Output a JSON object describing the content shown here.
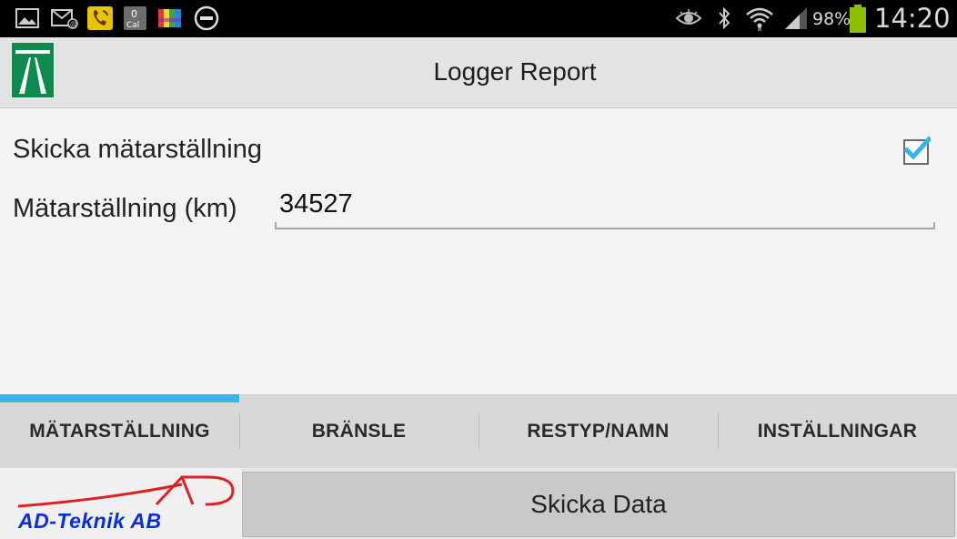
{
  "status_bar": {
    "battery_percent": "98%",
    "time": "14:20",
    "cal_badge": "0",
    "cal_label": "Cal",
    "icons": [
      "gallery-icon",
      "email-icon",
      "phone-call-icon",
      "calendar-icon",
      "colorgrid-icon",
      "dnd-icon",
      "eye-icon",
      "bluetooth-icon",
      "wifi-icon",
      "signal-icon",
      "battery-icon"
    ]
  },
  "action_bar": {
    "title": "Logger Report"
  },
  "form": {
    "send_reading_label": "Skicka mätarställning",
    "send_reading_checked": true,
    "reading_label": "Mätarställning (km)",
    "reading_value": "34527"
  },
  "tabs": [
    {
      "label": "MÄTARSTÄLLNING",
      "selected": true
    },
    {
      "label": "BRÄNSLE",
      "selected": false
    },
    {
      "label": "RESTYP/NAMN",
      "selected": false
    },
    {
      "label": "INSTÄLLNINGAR",
      "selected": false
    }
  ],
  "footer": {
    "company_name": "AD-Teknik AB",
    "send_button": "Skicka Data"
  },
  "colors": {
    "tab_indicator": "#33b5e5",
    "logo_green": "#0e8a4e",
    "company_blue": "#0a2fd8",
    "company_red": "#e02020"
  }
}
